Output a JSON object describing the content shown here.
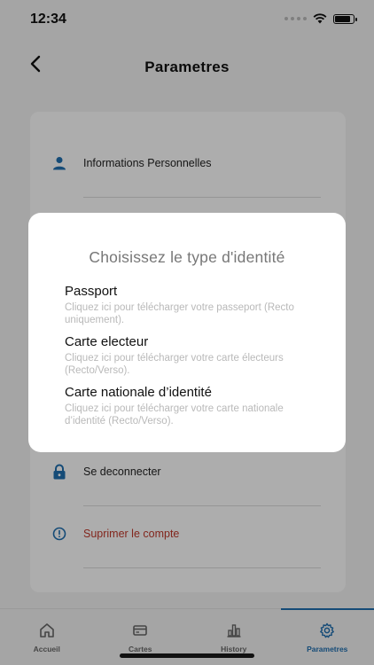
{
  "status_bar": {
    "time": "12:34"
  },
  "header": {
    "title": "Parametres"
  },
  "settings": {
    "items": [
      {
        "label": "Informations Personnelles"
      },
      {
        "label": "Se deconnecter"
      },
      {
        "label": "Suprimer le compte"
      }
    ]
  },
  "modal": {
    "title": "Choisissez le type d'identité",
    "options": [
      {
        "title": "Passport",
        "desc": "Cliquez ici pour télécharger votre passeport (Recto uniquement)."
      },
      {
        "title": "Carte electeur",
        "desc": "Cliquez ici pour télécharger votre carte électeurs (Recto/Verso)."
      },
      {
        "title": "Carte nationale d’identité",
        "desc": "Cliquez ici pour télécharger votre carte nationale d’identité (Recto/Verso)."
      }
    ]
  },
  "tabbar": {
    "tabs": [
      {
        "label": "Accueil",
        "icon": "home-icon"
      },
      {
        "label": "Cartes",
        "icon": "card-icon"
      },
      {
        "label": "History",
        "icon": "chart-icon"
      },
      {
        "label": "Parametres",
        "icon": "gear-icon"
      }
    ],
    "active_index": 3
  },
  "colors": {
    "accent": "#1f6fb0",
    "danger": "#c0392b"
  }
}
